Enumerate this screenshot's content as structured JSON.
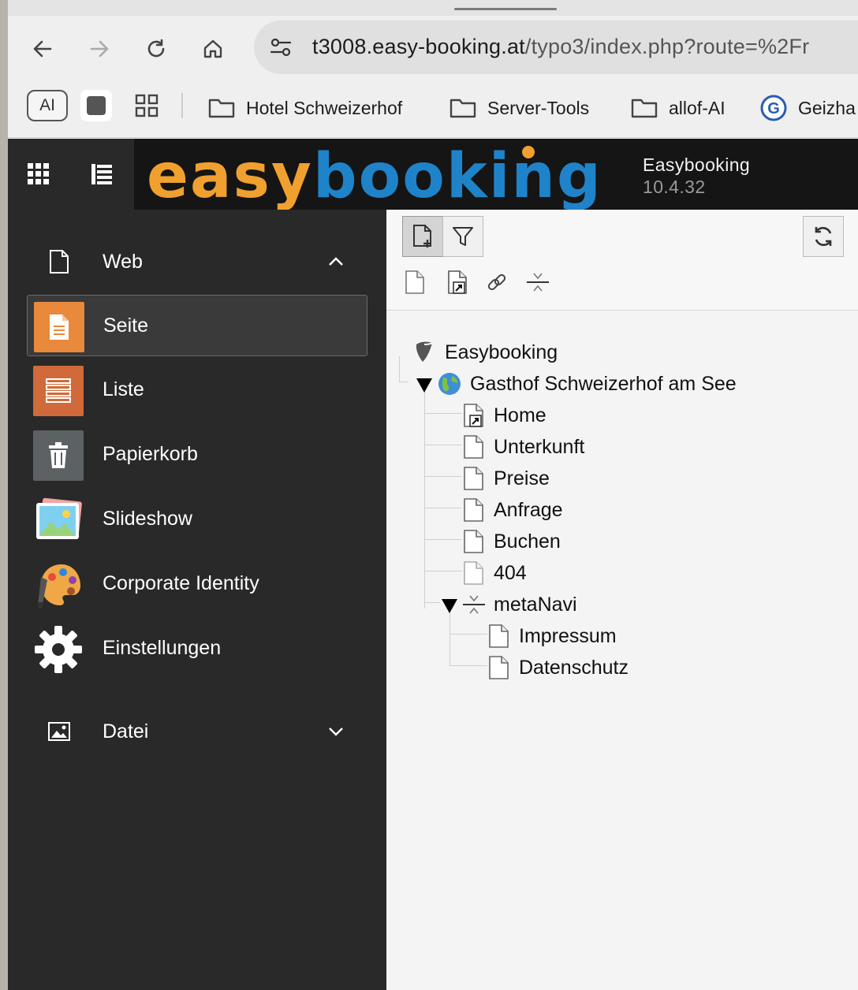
{
  "browser": {
    "url": "t3008.easy-booking.at",
    "url_path": "/typo3/index.php?route=%2Fr",
    "bookmarks": {
      "ai_label": "AI",
      "items": [
        {
          "label": "Hotel Schweizerhof",
          "icon": "folder-icon"
        },
        {
          "label": "Server-Tools",
          "icon": "folder-icon"
        },
        {
          "label": "allof-AI",
          "icon": "folder-icon"
        },
        {
          "label": "Geizha",
          "icon": "geizhals-icon"
        }
      ]
    }
  },
  "header": {
    "logo_part1": "easy",
    "logo_part2": "booking",
    "site_name": "Easybooking",
    "version": "10.4.32",
    "colors": {
      "logo_orange": "#f0a02e",
      "logo_blue": "#1f83c9"
    }
  },
  "modules": {
    "web": {
      "label": "Web",
      "expanded": true,
      "items": [
        {
          "label": "Seite",
          "active": true,
          "icon": "page-module-icon",
          "color": "#e8893c"
        },
        {
          "label": "Liste",
          "active": false,
          "icon": "list-module-icon",
          "color": "#d06a3a"
        },
        {
          "label": "Papierkorb",
          "active": false,
          "icon": "trash-icon",
          "color": "#5c6163"
        },
        {
          "label": "Slideshow",
          "active": false,
          "icon": "slideshow-icon"
        },
        {
          "label": "Corporate Identity",
          "active": false,
          "icon": "palette-icon"
        },
        {
          "label": "Einstellungen",
          "active": false,
          "icon": "gear-icon"
        }
      ]
    },
    "datei": {
      "label": "Datei",
      "expanded": false
    }
  },
  "tree": {
    "root": "Easybooking",
    "site": "Gasthof Schweizerhof am See",
    "pages": [
      "Home",
      "Unterkunft",
      "Preise",
      "Anfrage",
      "Buchen",
      "404"
    ],
    "folder": "metaNavi",
    "folder_pages": [
      "Impressum",
      "Datenschutz"
    ]
  }
}
